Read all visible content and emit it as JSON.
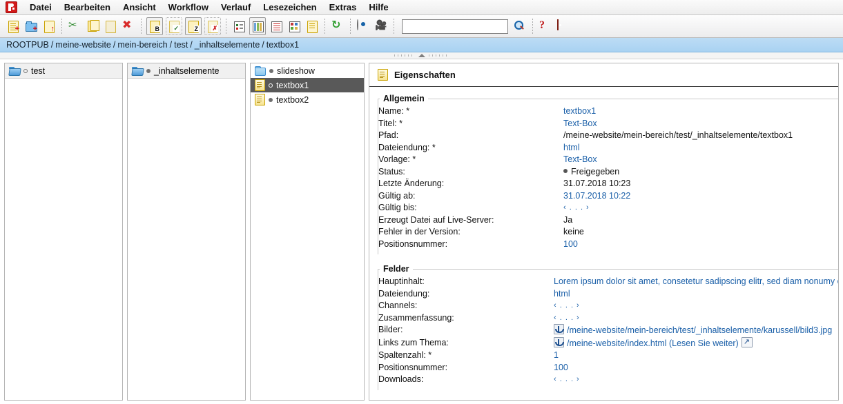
{
  "app": {
    "logo_name": "imperia-logo"
  },
  "menubar": {
    "items": [
      {
        "label": "Datei",
        "name": "menu-datei"
      },
      {
        "label": "Bearbeiten",
        "name": "menu-bearbeiten"
      },
      {
        "label": "Ansicht",
        "name": "menu-ansicht"
      },
      {
        "label": "Workflow",
        "name": "menu-workflow"
      },
      {
        "label": "Verlauf",
        "name": "menu-verlauf"
      },
      {
        "label": "Lesezeichen",
        "name": "menu-lesezeichen"
      },
      {
        "label": "Extras",
        "name": "menu-extras"
      },
      {
        "label": "Hilfe",
        "name": "menu-hilfe"
      }
    ]
  },
  "toolbar": {
    "search_value": "",
    "search_placeholder": "",
    "buttons": [
      {
        "name": "new-document-button",
        "icon": "new-document-icon"
      },
      {
        "name": "new-folder-button",
        "icon": "new-folder-icon"
      },
      {
        "name": "upload-document-button",
        "icon": "upload-document-icon"
      },
      {
        "name": "cut-button",
        "icon": "scissors-icon"
      },
      {
        "name": "copy-button",
        "icon": "copy-icon"
      },
      {
        "name": "paste-button",
        "icon": "paste-icon"
      },
      {
        "name": "delete-button",
        "icon": "red-x-icon"
      },
      {
        "name": "bold-document-button",
        "icon": "document-b-icon"
      },
      {
        "name": "checkin-button",
        "icon": "document-check-icon"
      },
      {
        "name": "zip-document-button",
        "icon": "document-z-icon"
      },
      {
        "name": "discard-button",
        "icon": "document-x-icon"
      },
      {
        "name": "tree-view-button",
        "icon": "tree-view-icon"
      },
      {
        "name": "column-view-button",
        "icon": "column-view-icon"
      },
      {
        "name": "list-view-button",
        "icon": "list-view-icon"
      },
      {
        "name": "thumbnail-view-button",
        "icon": "thumbnail-view-icon"
      },
      {
        "name": "detail-view-button",
        "icon": "detail-view-icon"
      },
      {
        "name": "reload-button",
        "icon": "refresh-icon"
      },
      {
        "name": "preview-button",
        "icon": "eye-icon"
      },
      {
        "name": "media-button",
        "icon": "film-camera-icon"
      },
      {
        "name": "search-button",
        "icon": "magnifier-icon"
      },
      {
        "name": "help-button",
        "icon": "question-mark-icon"
      },
      {
        "name": "logout-button",
        "icon": "exit-door-icon"
      }
    ]
  },
  "breadcrumb": {
    "separator": "/",
    "items": [
      "ROOTPUB",
      "meine-website",
      "mein-bereich",
      "test",
      "_inhaltselemente",
      "textbox1"
    ]
  },
  "columns": [
    {
      "name": "column-test",
      "header": {
        "label": "test",
        "icon": "open-folder-icon",
        "marker": "hollow"
      },
      "rows": []
    },
    {
      "name": "column-inhaltselemente",
      "header": {
        "label": "_inhaltselemente",
        "icon": "open-folder-icon",
        "marker": "filled"
      },
      "rows": []
    },
    {
      "name": "column-items",
      "header": null,
      "rows": [
        {
          "label": "slideshow",
          "icon": "closed-folder-icon",
          "marker": "filled",
          "selected": false
        },
        {
          "label": "textbox1",
          "icon": "page-document-icon",
          "marker": "hollow",
          "selected": true
        },
        {
          "label": "textbox2",
          "icon": "page-document-icon",
          "marker": "filled",
          "selected": false
        }
      ]
    }
  ],
  "properties": {
    "title": "Eigenschaften",
    "title_icon": "document-properties-icon",
    "groups": [
      {
        "legend": "Allgemein",
        "name": "group-allgemein",
        "rows": [
          {
            "key": "Name: *",
            "value": "textbox1",
            "style": "link"
          },
          {
            "key": "Titel: *",
            "value": "Text-Box",
            "style": "link"
          },
          {
            "key": "Pfad:",
            "value": "/meine-website/mein-bereich/test/_inhaltselemente/textbox1",
            "style": "plain"
          },
          {
            "key": "Dateiendung: *",
            "value": "html",
            "style": "link"
          },
          {
            "key": "Vorlage: *",
            "value": "Text-Box",
            "style": "link"
          },
          {
            "key": "Status:",
            "value": "Freigegeben",
            "style": "status"
          },
          {
            "key": "Letzte Änderung:",
            "value": "31.07.2018 10:23",
            "style": "plain"
          },
          {
            "key": "Gültig ab:",
            "value": "31.07.2018 10:22",
            "style": "link"
          },
          {
            "key": "Gültig bis:",
            "value": "‹ . . . ›",
            "style": "empty"
          },
          {
            "key": "Erzeugt Datei auf Live-Server:",
            "value": "Ja",
            "style": "plain"
          },
          {
            "key": "Fehler in der Version:",
            "value": "keine",
            "style": "plain"
          },
          {
            "key": "Positionsnummer:",
            "value": "100",
            "style": "link"
          }
        ]
      },
      {
        "legend": "Felder",
        "name": "group-felder",
        "rows": [
          {
            "key": "Hauptinhalt:",
            "value": "Lorem ipsum dolor sit amet, consetetur sadipscing elitr, sed diam nonumy eirm ...",
            "style": "link-wrap"
          },
          {
            "key": "Dateiendung:",
            "value": "html",
            "style": "link"
          },
          {
            "key": "Channels:",
            "value": "‹ . . . ›",
            "style": "empty"
          },
          {
            "key": "Zusammenfassung:",
            "value": "‹ . . . ›",
            "style": "empty"
          },
          {
            "key": "Bilder:",
            "value": "/meine-website/mein-bereich/test/_inhaltselemente/karussell/bild3.jpg",
            "style": "anchor-link"
          },
          {
            "key": "Links zum Thema:",
            "value": "/meine-website/index.html (Lesen Sie weiter)",
            "style": "anchor-link-ext"
          },
          {
            "key": "Spaltenzahl: *",
            "value": "1",
            "style": "link"
          },
          {
            "key": "Positionsnummer:",
            "value": "100",
            "style": "link"
          },
          {
            "key": "Downloads:",
            "value": "‹ . . . ›",
            "style": "empty"
          }
        ]
      }
    ]
  },
  "colors": {
    "breadcrumb_bg": "#a9d2f2",
    "selection_bg": "#595959",
    "link": "#1a5fa8",
    "accent_red": "#d21a1a"
  }
}
